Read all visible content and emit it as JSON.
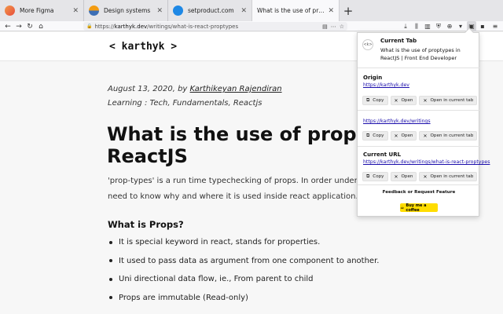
{
  "browser": {
    "tabs": [
      {
        "title": "More Figma",
        "favicon_color": "#e67e22"
      },
      {
        "title": "Design systems",
        "favicon_color": "#3d6fb5"
      },
      {
        "title": "setproduct.com",
        "favicon_color": "#1e88e5"
      },
      {
        "title": "What is the use of proptypes i...",
        "favicon_color": "#777777",
        "active": true
      }
    ],
    "url_prefix": "https://",
    "url_domain": "karthyk.dev",
    "url_path": "/writings/what-is-react-proptypes"
  },
  "site": {
    "brand": "< karthyk >",
    "date_line": "August 13, 2020, by ",
    "author": "Karthikeyan Rajendiran",
    "tags_line": "Learning : Tech, Fundamentals, Reactjs",
    "title_line1": "What is the use of proptypes in",
    "title_line2": "ReactJS",
    "intro_line1": "'prop-types' is a run time typechecking of props. In order understand prop-types, we",
    "intro_line2": "need to know why and where it is used inside react application.",
    "section_heading": "What is Props?",
    "bullets": [
      "It is special keyword in react, stands for properties.",
      "It used to pass data as argument from one component to another.",
      "Uni directional data flow, ie., From parent to child",
      "Props are immutable (Read-only)"
    ]
  },
  "popup": {
    "header_title": "Current Tab",
    "header_desc": "What is the use of proptypes in ReactJS | Front End Developer",
    "origin_title": "Origin",
    "origin_url": "https://karthyk.dev",
    "writings_url": "https://karthyk.dev/writings",
    "current_title": "Current URL",
    "current_url": "https://karthyk.dev/writings/what-is-react-proptypes",
    "copy_label": "Copy",
    "open_label": "Open",
    "open_current_label": "Open in current tab",
    "feedback": "Feedback or Request Feature",
    "coffee": "Buy me a coffee"
  },
  "colors": {
    "link": "#1a0dab",
    "coffee": "#ffdd00",
    "tab_active": "#f9f9fb",
    "tabstrip": "#e5e5e8"
  }
}
